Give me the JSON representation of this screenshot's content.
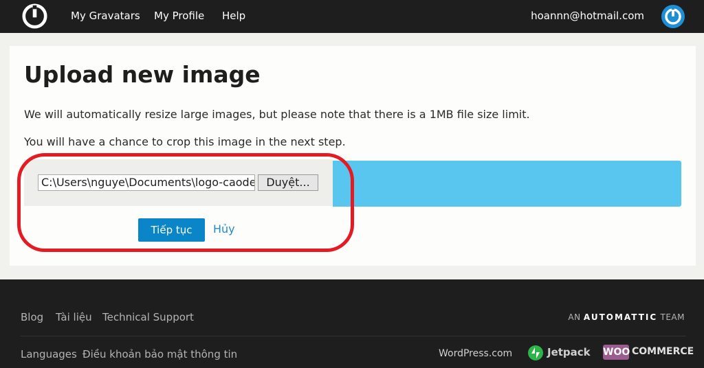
{
  "header": {
    "nav": [
      "My Gravatars",
      "My Profile",
      "Help"
    ],
    "user_email": "hoannn@hotmail.com"
  },
  "main": {
    "title": "Upload new image",
    "desc1": "We will automatically resize large images, but please note that there is a 1MB file size limit.",
    "desc2": "You will have a chance to crop this image in the next step.",
    "file_path": "C:\\Users\\nguye\\Documents\\logo-caodem",
    "browse_label": "Duyệt...",
    "continue_label": "Tiếp tục",
    "cancel_label": "Hủy"
  },
  "footer": {
    "links_row1": [
      "Blog",
      "Tài liệu",
      "Technical Support"
    ],
    "links_row2": [
      "Languages",
      "Điều khoản bảo mật thông tin"
    ],
    "an_label": "AN",
    "automattic_label": "AUTOMATTIC",
    "team_label": "TEAM",
    "wordpress_label": "WordPress.com",
    "jetpack_label": "Jetpack",
    "woo_label": "WOO",
    "commerce_label": "COMMERCE"
  },
  "colors": {
    "header_bg": "#1e1e1e",
    "accent_blue": "#0a85c8",
    "progress_blue": "#59c6f0",
    "highlight_red": "#e41b23"
  }
}
